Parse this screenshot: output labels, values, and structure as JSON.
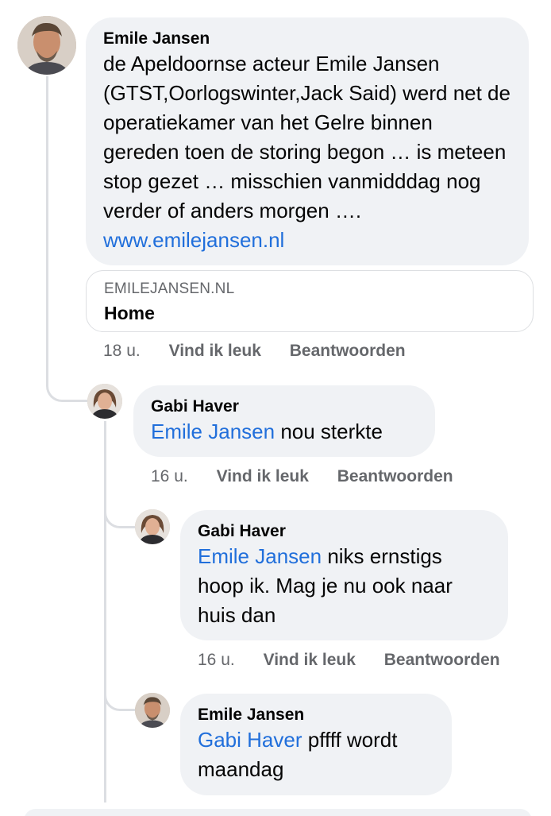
{
  "comments": [
    {
      "author": "Emile Jansen",
      "text": "de Apeldoornse acteur Emile Jansen (GTST,Oorlogswinter,Jack Said) werd net de operatiekamer van het Gelre binnen gereden toen de storing begon … is meteen stop gezet … misschien vanmidddag nog verder of anders morgen ….",
      "link_text": "www.emilejansen.nl",
      "link_preview": {
        "domain": "EMILEJANSEN.NL",
        "title": "Home"
      },
      "time": "18 u.",
      "like_label": "Vind ik leuk",
      "reply_label": "Beantwoorden"
    },
    {
      "author": "Gabi Haver",
      "mention": "Emile Jansen",
      "text": "nou sterkte",
      "time": "16 u.",
      "like_label": "Vind ik leuk",
      "reply_label": "Beantwoorden"
    },
    {
      "author": "Gabi Haver",
      "mention": "Emile Jansen",
      "text": "niks ernstigs hoop ik. Mag je nu ook naar huis dan",
      "time": "16 u.",
      "like_label": "Vind ik leuk",
      "reply_label": "Beantwoorden"
    },
    {
      "author": "Emile Jansen",
      "mention": "Gabi Haver",
      "text": "pffff wordt maandag"
    }
  ],
  "colors": {
    "mention": "#216fdb",
    "bubble": "#f0f2f5",
    "meta": "#65676b"
  }
}
